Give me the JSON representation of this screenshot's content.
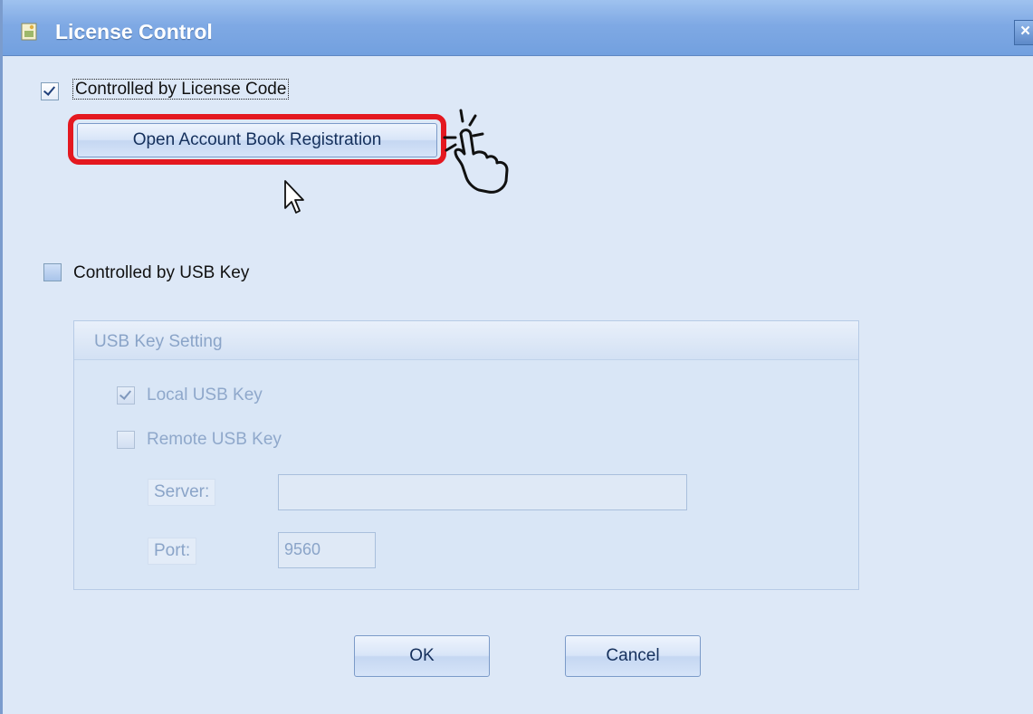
{
  "window": {
    "title": "License Control",
    "close_symbol": "×"
  },
  "license_code": {
    "label": "Controlled by License Code",
    "checked": true
  },
  "open_registration_button": {
    "label": "Open Account Book Registration"
  },
  "usb_key": {
    "label": "Controlled by USB Key",
    "checked": false
  },
  "usb_settings": {
    "title": "USB Key Setting",
    "local_usb_key": {
      "label": "Local USB Key",
      "checked": true
    },
    "remote_usb_key": {
      "label": "Remote USB Key",
      "checked": false
    },
    "server": {
      "label": "Server:",
      "value": ""
    },
    "port": {
      "label": "Port:",
      "value": "9560"
    }
  },
  "footer": {
    "ok_label": "OK",
    "cancel_label": "Cancel"
  },
  "colors": {
    "highlight": "#e41820",
    "titlebar": "#7fa9e4",
    "dialog_bg": "#dde8f7"
  }
}
